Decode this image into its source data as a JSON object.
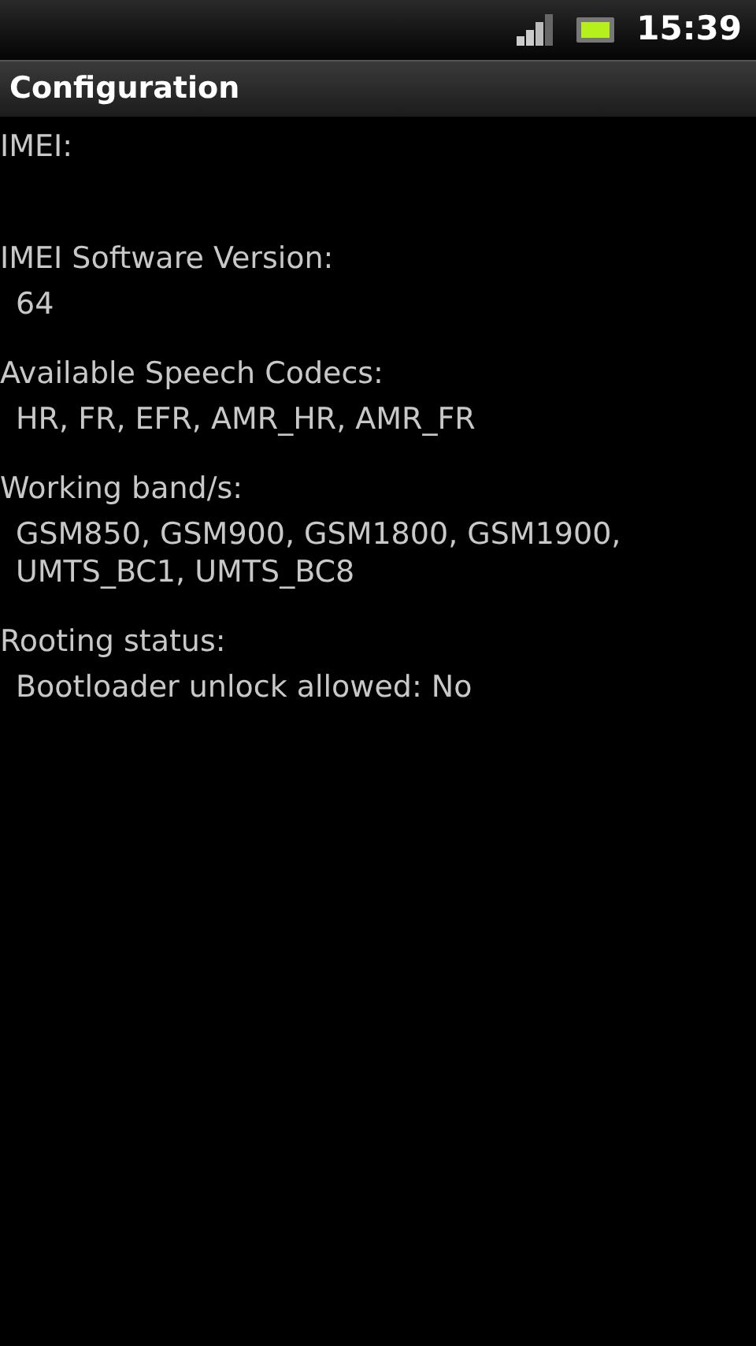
{
  "status_bar": {
    "time": "15:39"
  },
  "title": "Configuration",
  "sections": [
    {
      "label": "IMEI:"
    },
    {
      "label": "IMEI Software Version:",
      "value": "64"
    },
    {
      "label": "Available Speech Codecs:",
      "value": "HR, FR, EFR, AMR_HR, AMR_FR"
    },
    {
      "label": "Working band/s:",
      "value": "GSM850, GSM900, GSM1800, GSM1900, UMTS_BC1, UMTS_BC8"
    },
    {
      "label": "Rooting status:",
      "value": "Bootloader unlock allowed: No"
    }
  ]
}
